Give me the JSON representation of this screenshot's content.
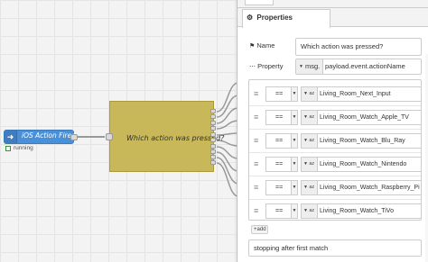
{
  "canvas": {
    "ios_node": {
      "label": "iOS Action Fired",
      "icon": "arrow-right-icon",
      "color": "#4a90d9"
    },
    "status": {
      "text": "running",
      "color": "#2e9c2e"
    },
    "switch_node": {
      "label": "Which action was pressed?",
      "icon": "switch-icon",
      "color": "#c8b85a"
    }
  },
  "panel": {
    "tab_label": "Properties",
    "name_label": "Name",
    "name_value": "Which action was pressed?",
    "property_label": "Property",
    "property_type": "msg.",
    "property_value": "payload.event.actionName",
    "rules": [
      {
        "op": "==",
        "type": "az",
        "value": "Living_Room_Next_Input"
      },
      {
        "op": "==",
        "type": "az",
        "value": "Living_Room_Watch_Apple_TV"
      },
      {
        "op": "==",
        "type": "az",
        "value": "Living_Room_Watch_Blu_Ray"
      },
      {
        "op": "==",
        "type": "az",
        "value": "Living_Room_Watch_Nintendo"
      },
      {
        "op": "==",
        "type": "az",
        "value": "Living_Room_Watch_Raspberry_Pi"
      },
      {
        "op": "==",
        "type": "az",
        "value": "Living_Room_Watch_TiVo"
      }
    ],
    "add_label": "add",
    "stop_mode": "stopping after first match"
  }
}
